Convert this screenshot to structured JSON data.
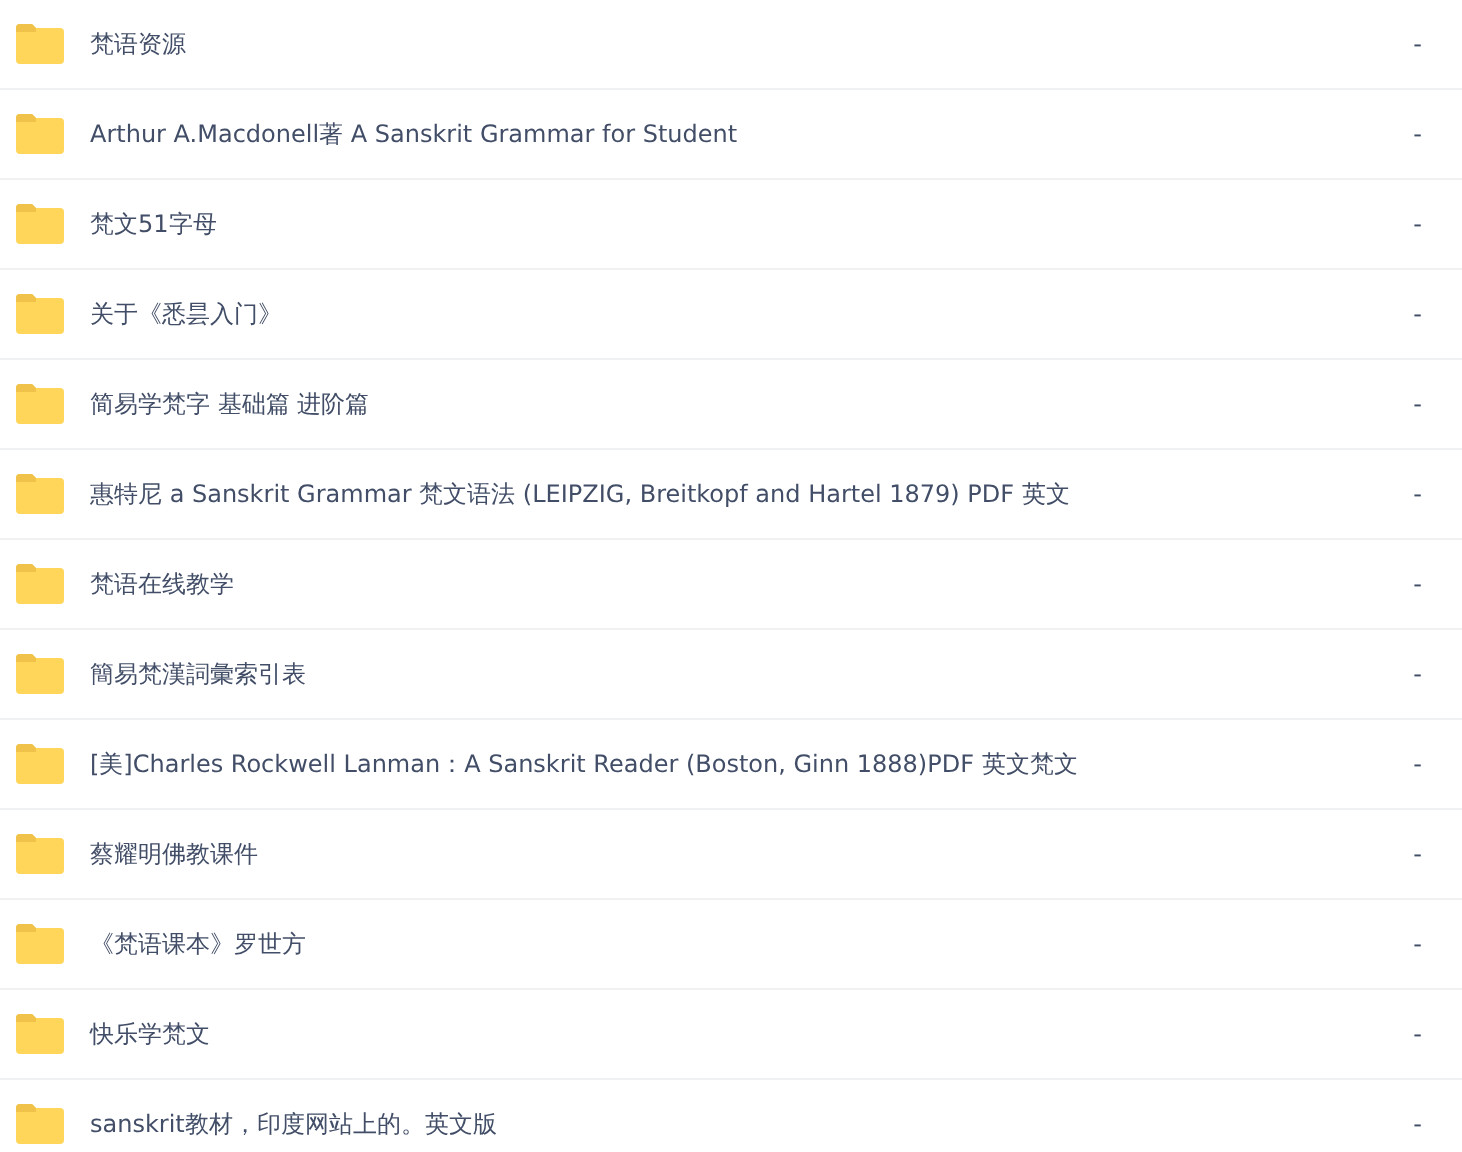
{
  "files": [
    {
      "name": "梵语资源",
      "size": "-"
    },
    {
      "name": "Arthur A.Macdonell著 A Sanskrit Grammar for Student",
      "size": "-"
    },
    {
      "name": "梵文51字母",
      "size": "-"
    },
    {
      "name": "关于《悉昙入门》",
      "size": "-"
    },
    {
      "name": "简易学梵字 基础篇 进阶篇",
      "size": "-"
    },
    {
      "name": "惠特尼 a Sanskrit Grammar 梵文语法 (LEIPZIG, Breitkopf and Hartel 1879) PDF 英文",
      "size": "-"
    },
    {
      "name": "梵语在线教学",
      "size": "-"
    },
    {
      "name": "簡易梵漢詞彙索引表",
      "size": "-"
    },
    {
      "name": "[美]Charles Rockwell Lanman：A Sanskrit Reader (Boston, Ginn 1888)PDF 英文梵文",
      "size": "-"
    },
    {
      "name": "蔡耀明佛教课件",
      "size": "-"
    },
    {
      "name": "《梵语课本》罗世方",
      "size": "-"
    },
    {
      "name": "快乐学梵文",
      "size": "-"
    },
    {
      "name": "sanskrit教材，印度网站上的。英文版",
      "size": "-"
    }
  ]
}
